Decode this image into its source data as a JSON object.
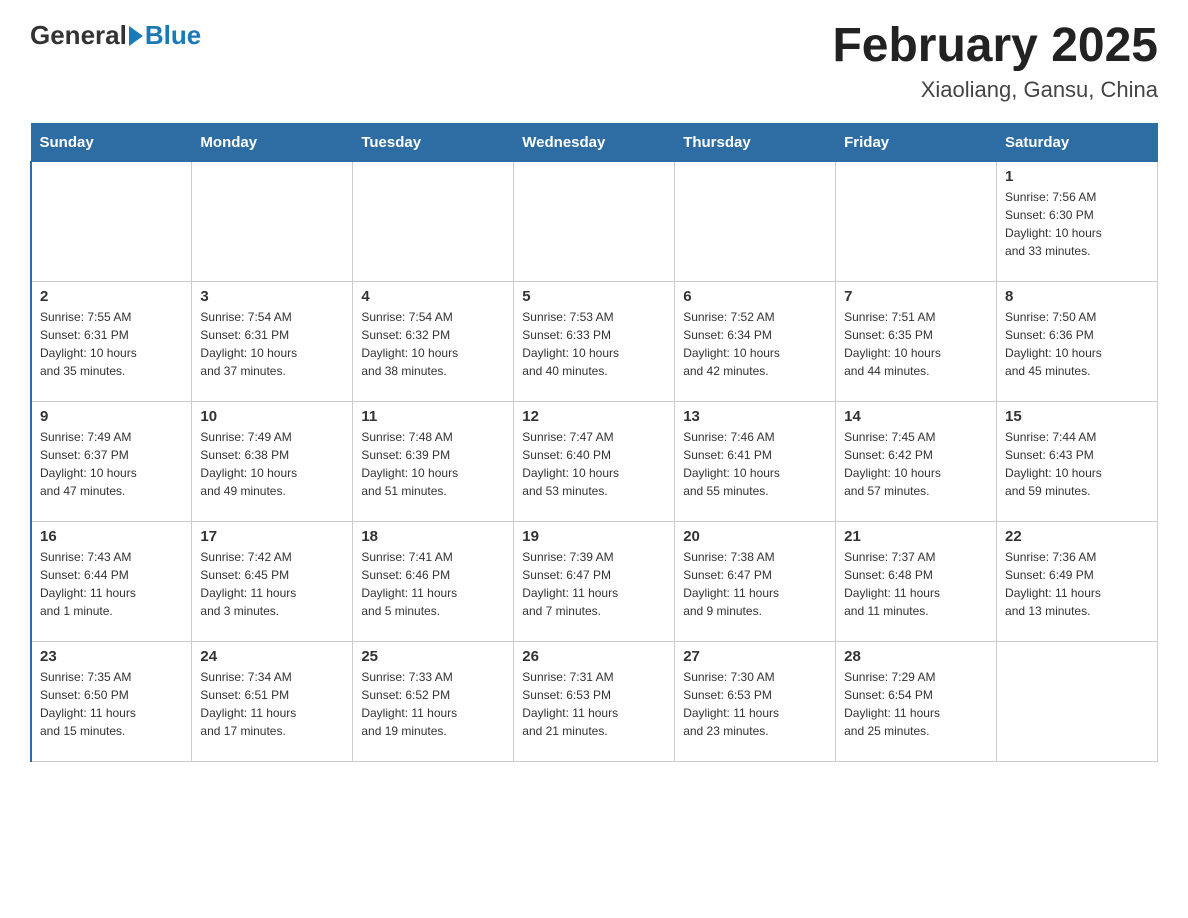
{
  "header": {
    "logo_general": "General",
    "logo_blue": "Blue",
    "month_title": "February 2025",
    "location": "Xiaoliang, Gansu, China"
  },
  "weekdays": [
    "Sunday",
    "Monday",
    "Tuesday",
    "Wednesday",
    "Thursday",
    "Friday",
    "Saturday"
  ],
  "weeks": [
    [
      {
        "day": "",
        "info": ""
      },
      {
        "day": "",
        "info": ""
      },
      {
        "day": "",
        "info": ""
      },
      {
        "day": "",
        "info": ""
      },
      {
        "day": "",
        "info": ""
      },
      {
        "day": "",
        "info": ""
      },
      {
        "day": "1",
        "info": "Sunrise: 7:56 AM\nSunset: 6:30 PM\nDaylight: 10 hours\nand 33 minutes."
      }
    ],
    [
      {
        "day": "2",
        "info": "Sunrise: 7:55 AM\nSunset: 6:31 PM\nDaylight: 10 hours\nand 35 minutes."
      },
      {
        "day": "3",
        "info": "Sunrise: 7:54 AM\nSunset: 6:31 PM\nDaylight: 10 hours\nand 37 minutes."
      },
      {
        "day": "4",
        "info": "Sunrise: 7:54 AM\nSunset: 6:32 PM\nDaylight: 10 hours\nand 38 minutes."
      },
      {
        "day": "5",
        "info": "Sunrise: 7:53 AM\nSunset: 6:33 PM\nDaylight: 10 hours\nand 40 minutes."
      },
      {
        "day": "6",
        "info": "Sunrise: 7:52 AM\nSunset: 6:34 PM\nDaylight: 10 hours\nand 42 minutes."
      },
      {
        "day": "7",
        "info": "Sunrise: 7:51 AM\nSunset: 6:35 PM\nDaylight: 10 hours\nand 44 minutes."
      },
      {
        "day": "8",
        "info": "Sunrise: 7:50 AM\nSunset: 6:36 PM\nDaylight: 10 hours\nand 45 minutes."
      }
    ],
    [
      {
        "day": "9",
        "info": "Sunrise: 7:49 AM\nSunset: 6:37 PM\nDaylight: 10 hours\nand 47 minutes."
      },
      {
        "day": "10",
        "info": "Sunrise: 7:49 AM\nSunset: 6:38 PM\nDaylight: 10 hours\nand 49 minutes."
      },
      {
        "day": "11",
        "info": "Sunrise: 7:48 AM\nSunset: 6:39 PM\nDaylight: 10 hours\nand 51 minutes."
      },
      {
        "day": "12",
        "info": "Sunrise: 7:47 AM\nSunset: 6:40 PM\nDaylight: 10 hours\nand 53 minutes."
      },
      {
        "day": "13",
        "info": "Sunrise: 7:46 AM\nSunset: 6:41 PM\nDaylight: 10 hours\nand 55 minutes."
      },
      {
        "day": "14",
        "info": "Sunrise: 7:45 AM\nSunset: 6:42 PM\nDaylight: 10 hours\nand 57 minutes."
      },
      {
        "day": "15",
        "info": "Sunrise: 7:44 AM\nSunset: 6:43 PM\nDaylight: 10 hours\nand 59 minutes."
      }
    ],
    [
      {
        "day": "16",
        "info": "Sunrise: 7:43 AM\nSunset: 6:44 PM\nDaylight: 11 hours\nand 1 minute."
      },
      {
        "day": "17",
        "info": "Sunrise: 7:42 AM\nSunset: 6:45 PM\nDaylight: 11 hours\nand 3 minutes."
      },
      {
        "day": "18",
        "info": "Sunrise: 7:41 AM\nSunset: 6:46 PM\nDaylight: 11 hours\nand 5 minutes."
      },
      {
        "day": "19",
        "info": "Sunrise: 7:39 AM\nSunset: 6:47 PM\nDaylight: 11 hours\nand 7 minutes."
      },
      {
        "day": "20",
        "info": "Sunrise: 7:38 AM\nSunset: 6:47 PM\nDaylight: 11 hours\nand 9 minutes."
      },
      {
        "day": "21",
        "info": "Sunrise: 7:37 AM\nSunset: 6:48 PM\nDaylight: 11 hours\nand 11 minutes."
      },
      {
        "day": "22",
        "info": "Sunrise: 7:36 AM\nSunset: 6:49 PM\nDaylight: 11 hours\nand 13 minutes."
      }
    ],
    [
      {
        "day": "23",
        "info": "Sunrise: 7:35 AM\nSunset: 6:50 PM\nDaylight: 11 hours\nand 15 minutes."
      },
      {
        "day": "24",
        "info": "Sunrise: 7:34 AM\nSunset: 6:51 PM\nDaylight: 11 hours\nand 17 minutes."
      },
      {
        "day": "25",
        "info": "Sunrise: 7:33 AM\nSunset: 6:52 PM\nDaylight: 11 hours\nand 19 minutes."
      },
      {
        "day": "26",
        "info": "Sunrise: 7:31 AM\nSunset: 6:53 PM\nDaylight: 11 hours\nand 21 minutes."
      },
      {
        "day": "27",
        "info": "Sunrise: 7:30 AM\nSunset: 6:53 PM\nDaylight: 11 hours\nand 23 minutes."
      },
      {
        "day": "28",
        "info": "Sunrise: 7:29 AM\nSunset: 6:54 PM\nDaylight: 11 hours\nand 25 minutes."
      },
      {
        "day": "",
        "info": ""
      }
    ]
  ]
}
